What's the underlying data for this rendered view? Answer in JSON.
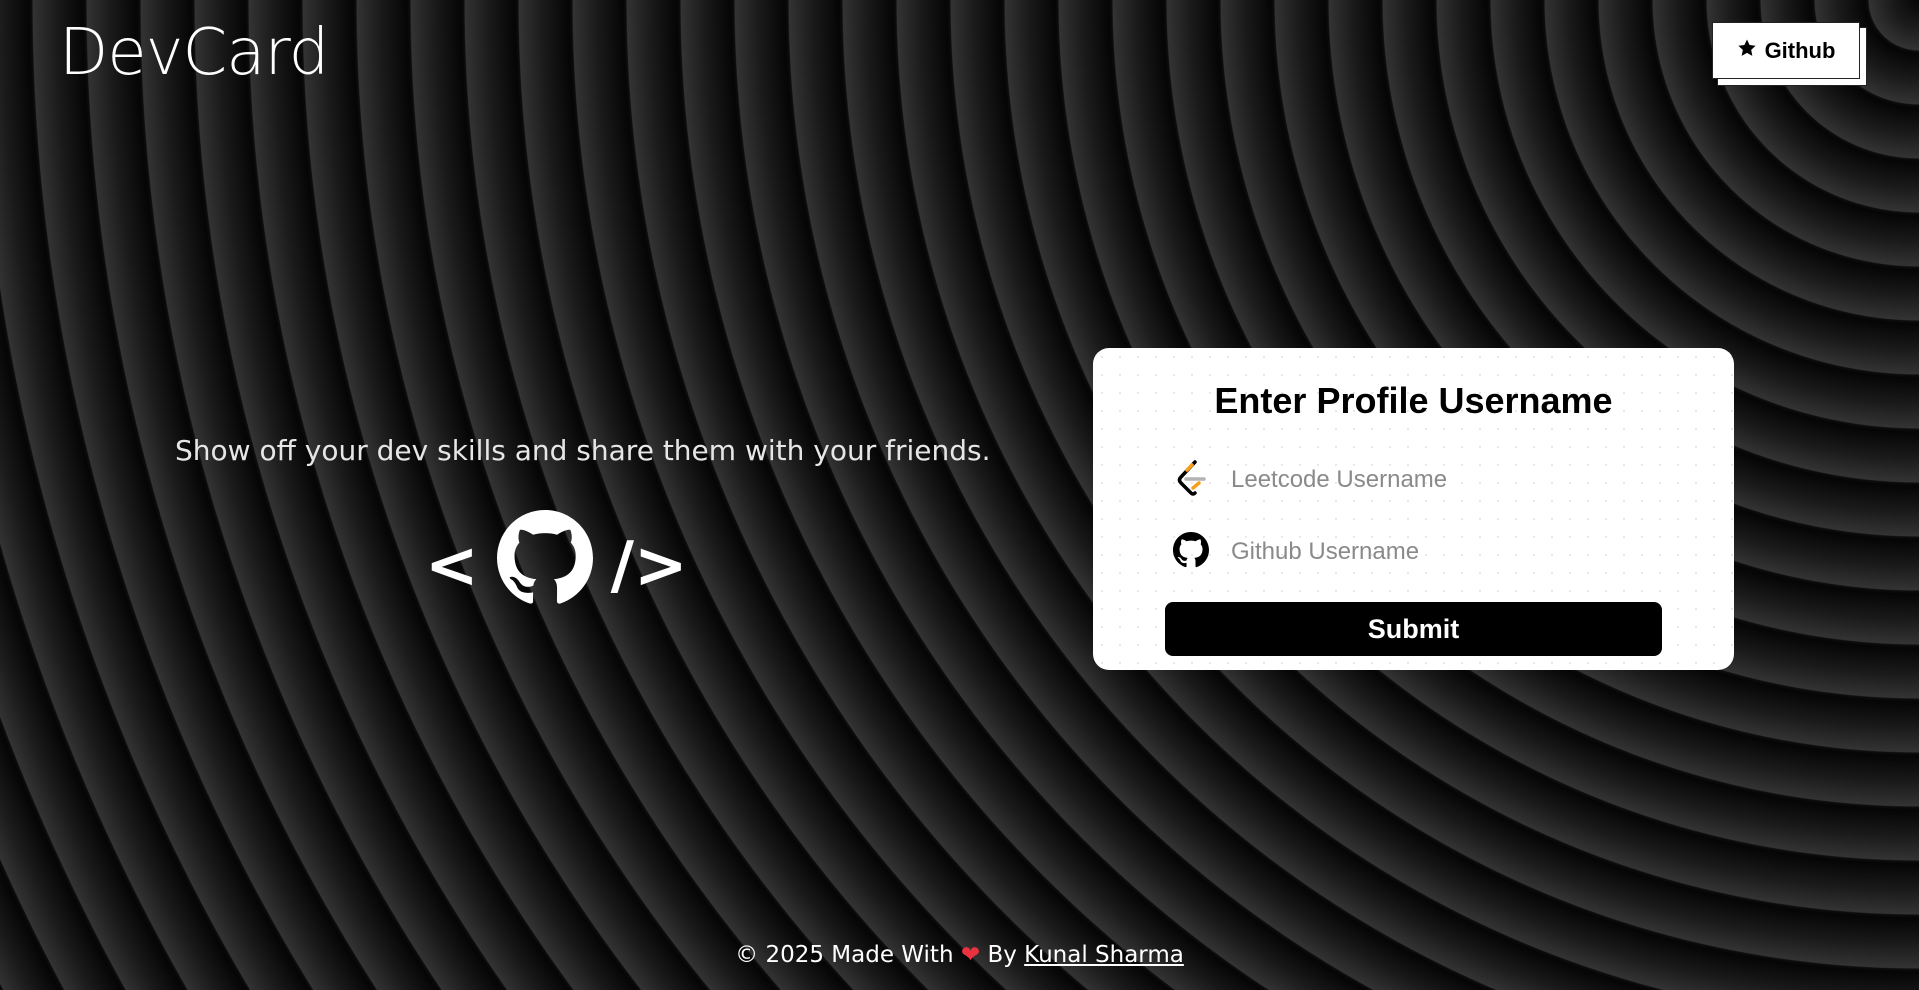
{
  "header": {
    "brand": "DevCard",
    "github_button_label": "Github",
    "github_icon": "star-icon"
  },
  "hero": {
    "tagline": "Show off your dev skills and share them with your friends.",
    "code_open": "<",
    "code_close": "/>",
    "logo_icon": "github-octocat-icon"
  },
  "form": {
    "title": "Enter Profile Username",
    "leetcode": {
      "placeholder": "Leetcode Username",
      "value": "",
      "icon": "leetcode-icon"
    },
    "github": {
      "placeholder": "Github Username",
      "value": "",
      "icon": "github-icon"
    },
    "submit_label": "Submit"
  },
  "footer": {
    "copyright": "© 2025 Made With",
    "heart": "❤",
    "by": "By",
    "author": "Kunal Sharma"
  },
  "colors": {
    "card_bg": "#ffffff",
    "button_bg": "#000000",
    "heart": "#e8323f",
    "leetcode_orange": "#f89f1b"
  }
}
